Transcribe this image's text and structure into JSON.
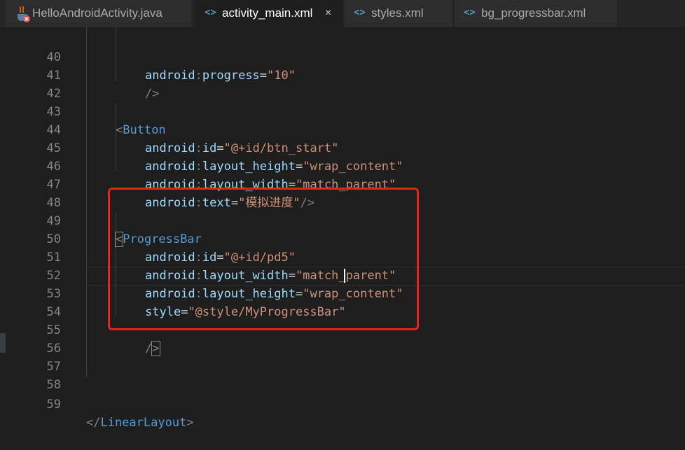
{
  "tabs": [
    {
      "label": "HelloAndroidActivity.java",
      "icon": "java-error-icon",
      "active": false
    },
    {
      "label": "activity_main.xml",
      "icon": "xml-icon",
      "active": true,
      "close": "×"
    },
    {
      "label": "styles.xml",
      "icon": "xml-icon",
      "active": false
    },
    {
      "label": "bg_progressbar.xml",
      "icon": "xml-icon",
      "active": false
    }
  ],
  "xml_icon_glyph": "<>",
  "lines": [
    {
      "n": "40",
      "ns": "android",
      "attr": "progress",
      "val": "\"10\""
    },
    {
      "n": "41",
      "close": "/>"
    },
    {
      "n": "42"
    },
    {
      "n": "43",
      "open": "<",
      "tag": "Button"
    },
    {
      "n": "44",
      "ns": "android",
      "attr": "id",
      "val": "\"@+id/btn_start\""
    },
    {
      "n": "45",
      "ns": "android",
      "attr": "layout_height",
      "val": "\"wrap_content\""
    },
    {
      "n": "46",
      "ns": "android",
      "attr": "layout_width",
      "val": "\"match_parent\""
    },
    {
      "n": "47",
      "ns": "android",
      "attr": "text",
      "val": "\"模拟进度\"",
      "close": "/>"
    },
    {
      "n": "48"
    },
    {
      "n": "49",
      "open": "<",
      "tag": "ProgressBar"
    },
    {
      "n": "50",
      "ns": "android",
      "attr": "id",
      "val": "\"@+id/pd5\""
    },
    {
      "n": "51",
      "ns": "android",
      "attr": "layout_width",
      "val": "\"match_parent\""
    },
    {
      "n": "52",
      "ns": "android",
      "attr": "layout_height",
      "val": "\"wrap_content\""
    },
    {
      "n": "53",
      "attr": "style",
      "val": "\"@style/MyProgressBar\""
    },
    {
      "n": "54"
    },
    {
      "n": "55",
      "close_a": "/",
      "close_b": ">"
    },
    {
      "n": "56"
    },
    {
      "n": "57"
    },
    {
      "n": "58"
    },
    {
      "n": "59",
      "open": "</",
      "tag": "LinearLayout",
      "end": ">"
    }
  ],
  "colors": {
    "background": "#1e1e1e",
    "attribute": "#9cdcfe",
    "string": "#ce9178",
    "tag": "#569cd6",
    "punctuation": "#808080",
    "line_number": "#858585",
    "highlight_box": "#e9221c"
  }
}
